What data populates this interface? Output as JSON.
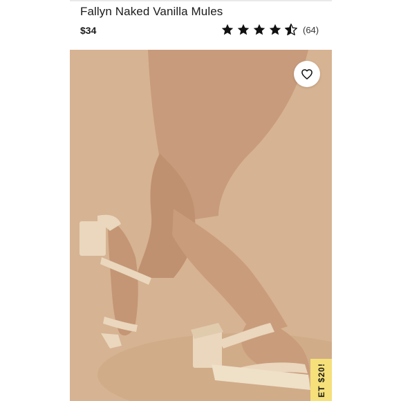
{
  "product": {
    "title": "Fallyn Naked Vanilla Mules",
    "price": "$34",
    "rating": {
      "value": 4.5,
      "max": 5,
      "review_count": "(64)"
    }
  },
  "photo": {
    "background_color": "#d6b392",
    "skin_color": "#c79b7b",
    "sandal_color": "#ead7bd"
  },
  "favorite": {
    "icon": "heart-outline-icon"
  },
  "promo": {
    "text": "ET $20!",
    "color": "#f5e07a"
  }
}
